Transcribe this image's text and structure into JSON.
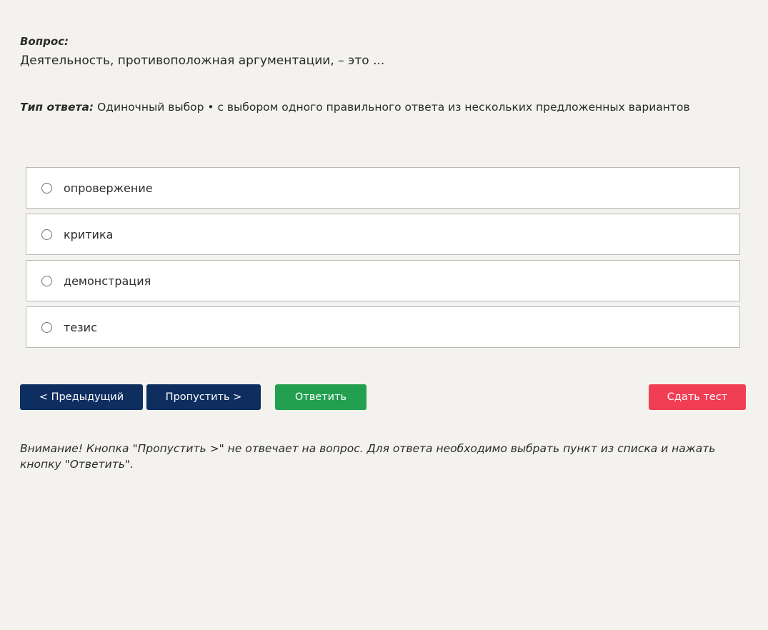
{
  "question": {
    "label": "Вопрос:",
    "text": "Деятельность, противоположная аргументации, – это ..."
  },
  "answer_type": {
    "label": "Тип ответа:",
    "value": "Одиночный выбор • с выбором одного правильного ответа из нескольких предложенных вариантов"
  },
  "options": [
    {
      "label": "опровержение"
    },
    {
      "label": "критика"
    },
    {
      "label": "демонстрация"
    },
    {
      "label": "тезис"
    }
  ],
  "buttons": {
    "prev": "< Предыдущий",
    "skip": "Пропустить >",
    "answer": "Ответить",
    "submit": "Сдать тест"
  },
  "colors": {
    "nav_button": "#0d2e5f",
    "answer_button": "#22a050",
    "submit_button": "#f23e55",
    "background": "#f3f2ef"
  },
  "notice": "Внимание! Кнопка \"Пропустить >\" не отвечает на вопрос. Для ответа необходимо выбрать пункт из списка и нажать кнопку \"Ответить\"."
}
